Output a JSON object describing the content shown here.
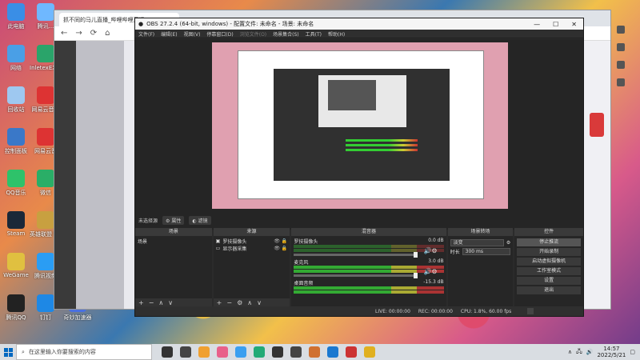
{
  "desktop": {
    "icons": [
      {
        "label": "此电脑",
        "color": "#3a8ee6"
      },
      {
        "label": "腾讯...",
        "color": "#6fb8ff"
      },
      {
        "label": "网络",
        "color": "#4a9fe6"
      },
      {
        "label": "InletexEX 屏幕共享",
        "color": "#2aa46a"
      },
      {
        "label": "回收站",
        "color": "#9ec8f0"
      },
      {
        "label": "网易云音乐",
        "color": "#d33"
      },
      {
        "label": "控制面板",
        "color": "#3a78c8"
      },
      {
        "label": "网易云音",
        "color": "#d33"
      },
      {
        "label": "QQ音乐",
        "color": "#2ec26a"
      },
      {
        "label": "微信",
        "color": "#2aae67"
      },
      {
        "label": "Steam",
        "color": "#1b2838"
      },
      {
        "label": "英雄联盟 WeGame",
        "color": "#c8a040"
      },
      {
        "label": "WeGame",
        "color": "#e0c040"
      },
      {
        "label": "腾讯视频",
        "color": "#2a9df4"
      },
      {
        "label": "腾讯QQ",
        "color": "#222"
      },
      {
        "label": "钉钉",
        "color": "#1e88e5"
      },
      {
        "label": "奇妙加速器",
        "color": "#4a70e0"
      }
    ]
  },
  "browser": {
    "tab_title": "抓不同的马儿直播_哔哩哔哩直播",
    "new_tab": "+",
    "nav": [
      "←",
      "→",
      "⟳",
      "⌂"
    ]
  },
  "obs": {
    "title": "OBS 27.2.4 (64-bit, windows) - 配置文件: 未命名 - 场景: 未命名",
    "window_controls": [
      "—",
      "☐",
      "✕"
    ],
    "menu": [
      "文件(F)",
      "编辑(E)",
      "视图(V)",
      "停靠窗口(D)",
      "浏览文件(O)",
      "场景集合(S)",
      "工具(T)",
      "帮助(H)"
    ],
    "scene_selector": {
      "label": "未选择源",
      "properties": "属性",
      "filters": "滤镜"
    },
    "docks": {
      "scenes": {
        "header": "场景",
        "items": [
          "场景"
        ]
      },
      "sources": {
        "header": "来源",
        "items": [
          "罗技摄像头",
          "显示器采集"
        ]
      },
      "mixer": {
        "header": "混音器",
        "channels": [
          {
            "name": "罗技摄像头",
            "db": "0.0 dB"
          },
          {
            "name": "麦克风",
            "db": "3.0 dB"
          },
          {
            "name": "桌面音频",
            "db": "-15.3 dB"
          }
        ]
      },
      "transitions": {
        "header": "场景转场",
        "type": "淡变",
        "duration_label": "时长",
        "duration": "300 ms"
      },
      "controls": {
        "header": "控件",
        "buttons": [
          "停止推流",
          "开始录制",
          "启动虚拟摄像机",
          "工作室模式",
          "设置",
          "退出"
        ]
      }
    },
    "status": {
      "live": "LIVE: 00:00:00",
      "rec": "REC: 00:00:00",
      "cpu": "CPU: 1.8%, 60.00 fps"
    }
  },
  "taskbar": {
    "search_placeholder": "在这里输入你要搜索的内容",
    "time": "14:57",
    "date": "2022/5/21",
    "app_colors": [
      "#333",
      "#444",
      "#f0a030",
      "#e8608a",
      "#3a9ff0",
      "#2a7",
      "#333",
      "#444",
      "#d07030",
      "#1a78d0",
      "#c33",
      "#e0b020"
    ]
  }
}
